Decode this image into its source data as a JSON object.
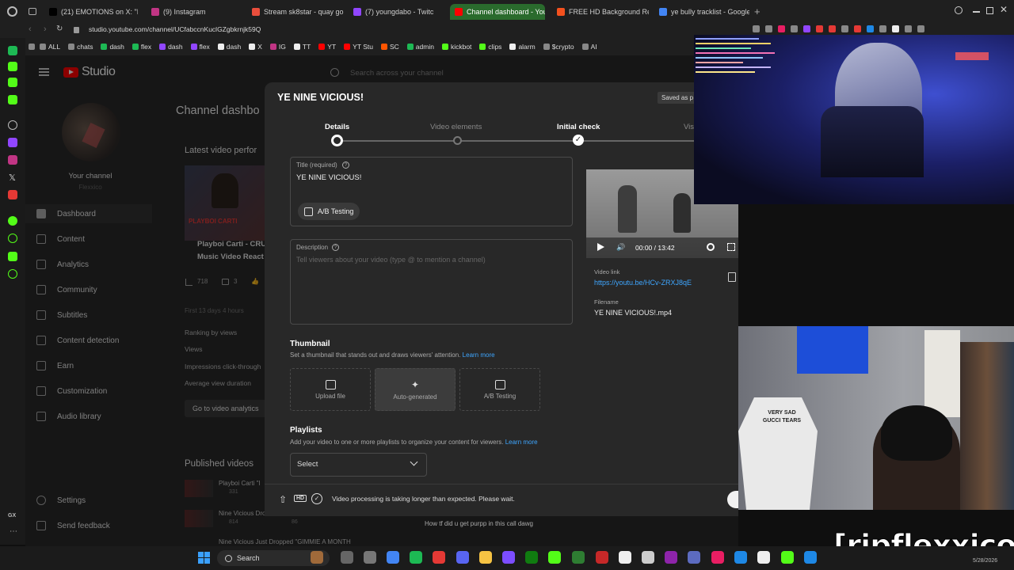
{
  "tabs": [
    {
      "label": "(21) EMOTIONS on X: \"Nin",
      "color": "#000"
    },
    {
      "label": "(9) Instagram",
      "color": "#c13584"
    },
    {
      "label": "Stream sk8star - quay go",
      "color": "#e94e3c"
    },
    {
      "label": "(7) youngdabo - Twitc",
      "color": "#9146ff"
    },
    {
      "label": "Channel dashboard - You",
      "color": "#ff0000"
    },
    {
      "label": "FREE HD Background Rem",
      "color": "#f4511e"
    },
    {
      "label": "ye bully tracklist - Google",
      "color": "#4285f4"
    }
  ],
  "address": "studio.youtube.com/channel/UCfabccnKuclGZgbkrnjk59Q",
  "bookmarks": [
    {
      "label": "ALL",
      "color": "#888"
    },
    {
      "label": "chats",
      "color": "#888"
    },
    {
      "label": "dash",
      "color": "#1db954"
    },
    {
      "label": "flex",
      "color": "#1db954"
    },
    {
      "label": "dash",
      "color": "#9146ff"
    },
    {
      "label": "flex",
      "color": "#9146ff"
    },
    {
      "label": "dash",
      "color": "#eee"
    },
    {
      "label": "X",
      "color": "#eee"
    },
    {
      "label": "IG",
      "color": "#c13584"
    },
    {
      "label": "TT",
      "color": "#eee"
    },
    {
      "label": "YT",
      "color": "#ff0000"
    },
    {
      "label": "YT Stu",
      "color": "#ff0000"
    },
    {
      "label": "SC",
      "color": "#ff5500"
    },
    {
      "label": "admin",
      "color": "#1db954"
    },
    {
      "label": "kickbot",
      "color": "#53fc18"
    },
    {
      "label": "clips",
      "color": "#53fc18"
    },
    {
      "label": "alarm",
      "color": "#eee"
    },
    {
      "label": "$crypto",
      "color": "#888"
    },
    {
      "label": "AI",
      "color": "#888"
    }
  ],
  "studio": {
    "logo": "Studio",
    "search_placeholder": "Search across your channel",
    "your_channel": "Your channel",
    "channel_name": "Flexxico",
    "page_title": "Channel dashbo",
    "nav": [
      "Dashboard",
      "Content",
      "Analytics",
      "Community",
      "Subtitles",
      "Content detection",
      "Earn",
      "Customization",
      "Audio library"
    ],
    "settings": "Settings",
    "feedback": "Send feedback",
    "latest_perf": "Latest video perfor",
    "latest_title_1": "Playboi Carti - CRU",
    "latest_title_2": "Music Video React",
    "stat_views": "718",
    "stat_comments": "3",
    "first_days": "First 13 days 4 hours",
    "ranking": "Ranking by views",
    "views_lbl": "Views",
    "impressions": "Impressions click-through",
    "avg_duration": "Average view duration",
    "go_analytics": "Go to video analytics",
    "published": "Published videos",
    "pub_1": "Playboi Carti \"I",
    "pub_1_views": "331",
    "pub_2": "Nine Vicious Dro",
    "pub_2_views": "814",
    "pub_2_likes": "86",
    "pub_3": "Nine Vicious Just Dropped \"GIMMIE A MONTH"
  },
  "modal": {
    "title": "YE NINE VICIOUS!",
    "saved": "Saved as p",
    "steps": [
      "Details",
      "Video elements",
      "Initial check",
      "Vis"
    ],
    "title_label": "Title (required)",
    "title_value": "YE NINE VICIOUS!",
    "ab_testing": "A/B Testing",
    "description_label": "Description",
    "description_placeholder": "Tell viewers about your video (type @ to mention a channel)",
    "time": "00:00 / 13:42",
    "video_link_label": "Video link",
    "video_link": "https://youtu.be/HCv-ZRXJ8qE",
    "filename_label": "Filename",
    "filename": "YE NINE VICIOUS!.mp4",
    "thumbnail_heading": "Thumbnail",
    "thumbnail_desc": "Set a thumbnail that stands out and draws viewers' attention.",
    "learn_more": "Learn more",
    "thumb_options": [
      "Upload file",
      "Auto-generated",
      "A/B Testing"
    ],
    "playlists_heading": "Playlists",
    "playlists_desc": "Add your video to one or more playlists to organize your content for viewers.",
    "select": "Select",
    "processing": "Video processing is taking longer than expected. Please wait."
  },
  "overlay": {
    "brand": "[ripflexxico]",
    "chat_line": "How tf did u get purpp in this call dawg",
    "shirt": "VERY SAD\nGUCCI TEARS"
  },
  "taskbar": {
    "search": "Search",
    "date": "5/28/2026"
  }
}
